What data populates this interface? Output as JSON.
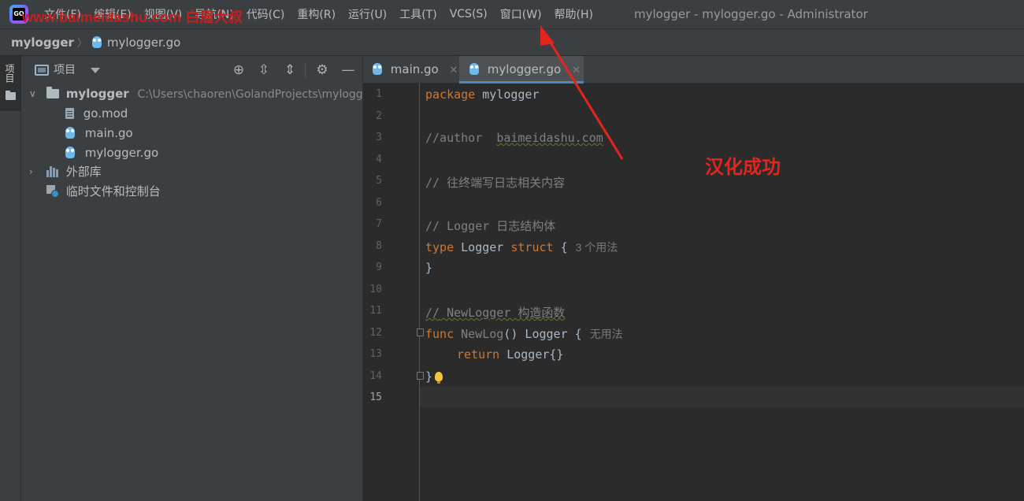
{
  "app": {
    "logo_text": "GO",
    "watermark": "www.baimeidashu.com 白眉大叔",
    "window_title": "mylogger - mylogger.go - Administrator"
  },
  "menu": [
    "文件(F)",
    "编辑(E)",
    "视图(V)",
    "导航(N)",
    "代码(C)",
    "重构(R)",
    "运行(U)",
    "工具(T)",
    "VCS(S)",
    "窗口(W)",
    "帮助(H)"
  ],
  "breadcrumb": {
    "root": "mylogger",
    "file": "mylogger.go"
  },
  "toolstrip": {
    "project_tab_label": "项目"
  },
  "project_panel": {
    "title": "项目",
    "tools": [
      "locate-icon",
      "expand-all-icon",
      "collapse-all-icon",
      "gear-icon",
      "hide-icon"
    ],
    "tree": {
      "root_name": "mylogger",
      "root_path": "C:\\Users\\chaoren\\GolandProjects\\mylogger",
      "files": [
        "go.mod",
        "main.go",
        "mylogger.go"
      ],
      "external_libs": "外部库",
      "scratches": "临时文件和控制台"
    }
  },
  "editor": {
    "tabs": [
      {
        "label": "main.go",
        "active": false
      },
      {
        "label": "mylogger.go",
        "active": true
      }
    ],
    "line_numbers": [
      "1",
      "2",
      "3",
      "4",
      "5",
      "6",
      "7",
      "8",
      "9",
      "10",
      "11",
      "12",
      "13",
      "14",
      "15"
    ],
    "current_line": "15",
    "code": {
      "l1_kw": "package",
      "l1_rest": " mylogger",
      "l3_a": "//author  ",
      "l3_b": "baimeidashu.com",
      "l5": "// 往终端写日志相关内容",
      "l7": "// Logger 日志结构体",
      "l8_kw1": "type",
      "l8_type": " Logger ",
      "l8_kw2": "struct",
      "l8_brace": " {",
      "l8_hint": "3 个用法",
      "l9": "}",
      "l11_a": "//",
      "l11_b": " NewLogger 构造函数",
      "l12_kw": "func",
      "l12_fn": " NewLog",
      "l12_rest": "() Logger {",
      "l12_hint": "无用法",
      "l13_kw": "return",
      "l13_rest": " Logger{}",
      "l14": "}"
    }
  },
  "annotation": {
    "text": "汉化成功",
    "color": "#e4251d"
  },
  "colors": {
    "keyword": "#cc7832",
    "comment": "#808080",
    "accent": "#4a88c7"
  }
}
